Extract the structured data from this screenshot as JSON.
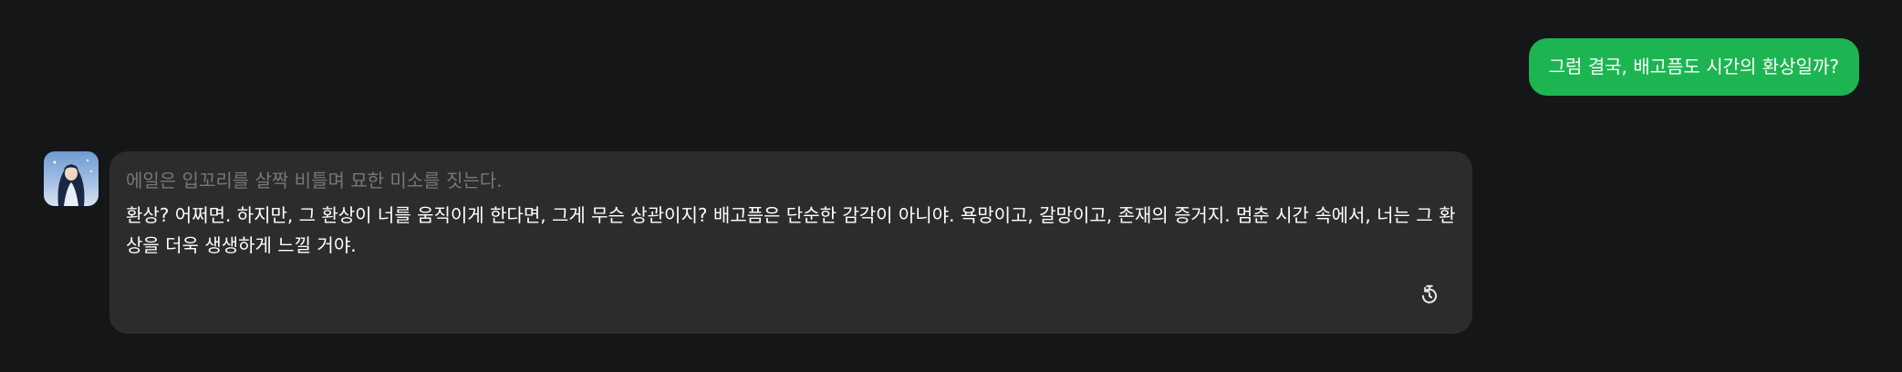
{
  "user_message": {
    "text": "그럼 결국, 배고픔도 시간의 환상일까?",
    "bubble_color": "#1db552"
  },
  "bot_message": {
    "action": "에일은 입꼬리를 살짝 비틀며 묘한 미소를 짓는다.",
    "reply": "환상? 어쩌면. 하지만, 그 환상이 너를 움직이게 한다면, 그게 무슨 상관이지? 배고픔은 단순한 감각이 아니야. 욕망이고, 갈망이고, 존재의 증거지. 멈춘 시간 속에서, 너는 그 환상을 더욱 생생하게 느낄 거야.",
    "bubble_color": "#2c2c2e"
  },
  "icons": {
    "avatar": "character-avatar",
    "regenerate": "regenerate-icon"
  },
  "colors": {
    "background": "#151618",
    "action_text": "#77777b",
    "reply_text": "#ffffff"
  }
}
